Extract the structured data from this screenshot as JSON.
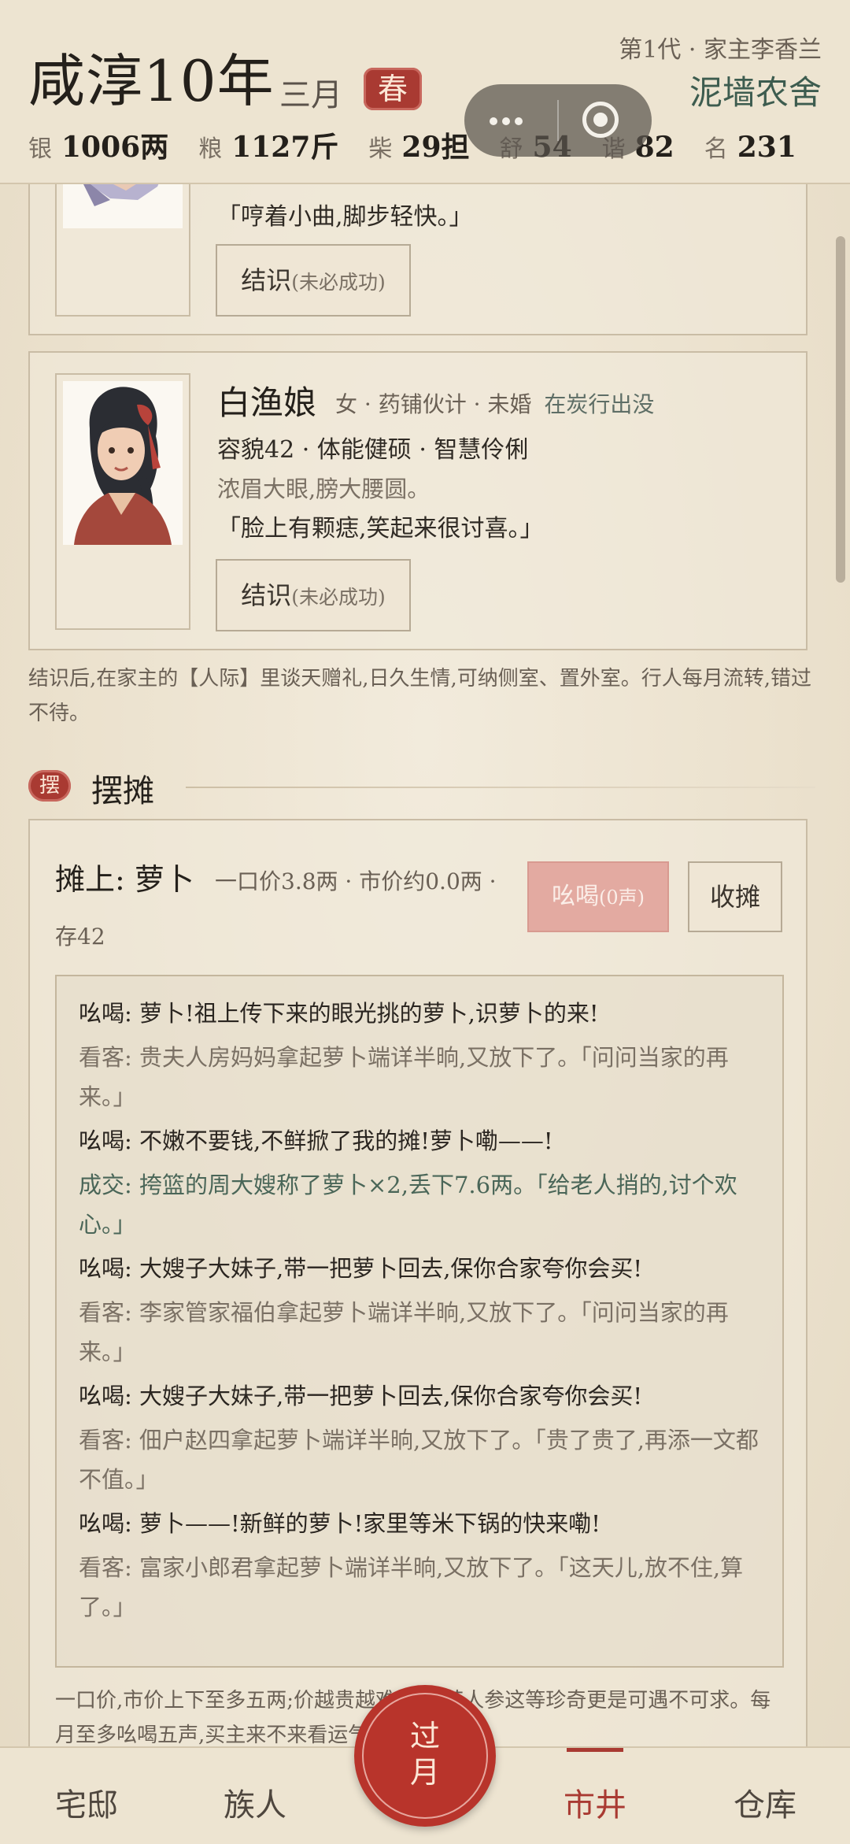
{
  "header": {
    "era_year": "咸淳10年",
    "month": "三月",
    "season": "春",
    "generation": "第1代 · 家主李香兰",
    "home": "泥墙农舍",
    "stats": [
      {
        "key": "银",
        "value": "1006两"
      },
      {
        "key": "粮",
        "value": "1127斤"
      },
      {
        "key": "柴",
        "value": "29担"
      },
      {
        "key": "舒",
        "value": "54"
      },
      {
        "key": "谐",
        "value": "82"
      },
      {
        "key": "名",
        "value": "231"
      }
    ]
  },
  "npc_prev": {
    "quote": "「哼着小曲,脚步轻快。」",
    "meet_label": "结识",
    "meet_hint": "(未必成功)"
  },
  "npc": {
    "name": "白渔娘",
    "meta": "女 · 药铺伙计 · 未婚",
    "location": "在炭行出没",
    "attrs": "容貌42 · 体能健硕 · 智慧伶俐",
    "desc": "浓眉大眼,膀大腰圆。",
    "quote": "「脸上有颗痣,笑起来很讨喜。」",
    "meet_label": "结识",
    "meet_hint": "(未必成功)"
  },
  "social_note": "结识后,在家主的【人际】里谈天赠礼,日久生情,可纳侧室、置外室。行人每月流转,错过不待。",
  "stall": {
    "section_badge": "摆",
    "section_title": "摆摊",
    "title": "摊上: 萝卜",
    "price": "一口价3.8两 · 市价约0.0两 ·",
    "stock": "存42",
    "hawk_label": "吆喝",
    "hawk_count": "(0声)",
    "close_label": "收摊",
    "log": [
      {
        "type": "call",
        "text": "吆喝: 萝卜!祖上传下来的眼光挑的萝卜,识萝卜的来!"
      },
      {
        "type": "visitor",
        "text": "看客: 贵夫人房妈妈拿起萝卜端详半晌,又放下了。「问问当家的再来。」"
      },
      {
        "type": "call",
        "text": "吆喝: 不嫩不要钱,不鲜掀了我的摊!萝卜嘞——!"
      },
      {
        "type": "deal",
        "text": "成交: 挎篮的周大嫂称了萝卜×2,丢下7.6两。「给老人捎的,讨个欢心。」"
      },
      {
        "type": "call",
        "text": "吆喝: 大嫂子大妹子,带一把萝卜回去,保你合家夸你会买!"
      },
      {
        "type": "visitor",
        "text": "看客: 李家管家福伯拿起萝卜端详半晌,又放下了。「问问当家的再来。」"
      },
      {
        "type": "call",
        "text": "吆喝: 大嫂子大妹子,带一把萝卜回去,保你合家夸你会买!"
      },
      {
        "type": "visitor",
        "text": "看客: 佃户赵四拿起萝卜端详半晌,又放下了。「贵了贵了,再添一文都不值。」"
      },
      {
        "type": "call",
        "text": "吆喝: 萝卜——!新鲜的萝卜!家里等米下锅的快来嘞!"
      },
      {
        "type": "visitor",
        "text": "看客: 富家小郎君拿起萝卜端详半晌,又放下了。「这天儿,放不住,算了。」"
      }
    ],
    "footnote": "一口价,市价上下至多五两;价越贵越难卖,灵芝人参这等珍奇更是可遇不可求。每月至多吆喝五声,买主来不来看运气。"
  },
  "nav": {
    "items": [
      "宅邸",
      "族人",
      "市井",
      "仓库"
    ],
    "active": "市井",
    "month_btn": "过月"
  },
  "colors": {
    "accent_red": "#a93a32",
    "paper": "#ece3d1",
    "ink": "#24201b",
    "jade": "#3d5c4f"
  }
}
